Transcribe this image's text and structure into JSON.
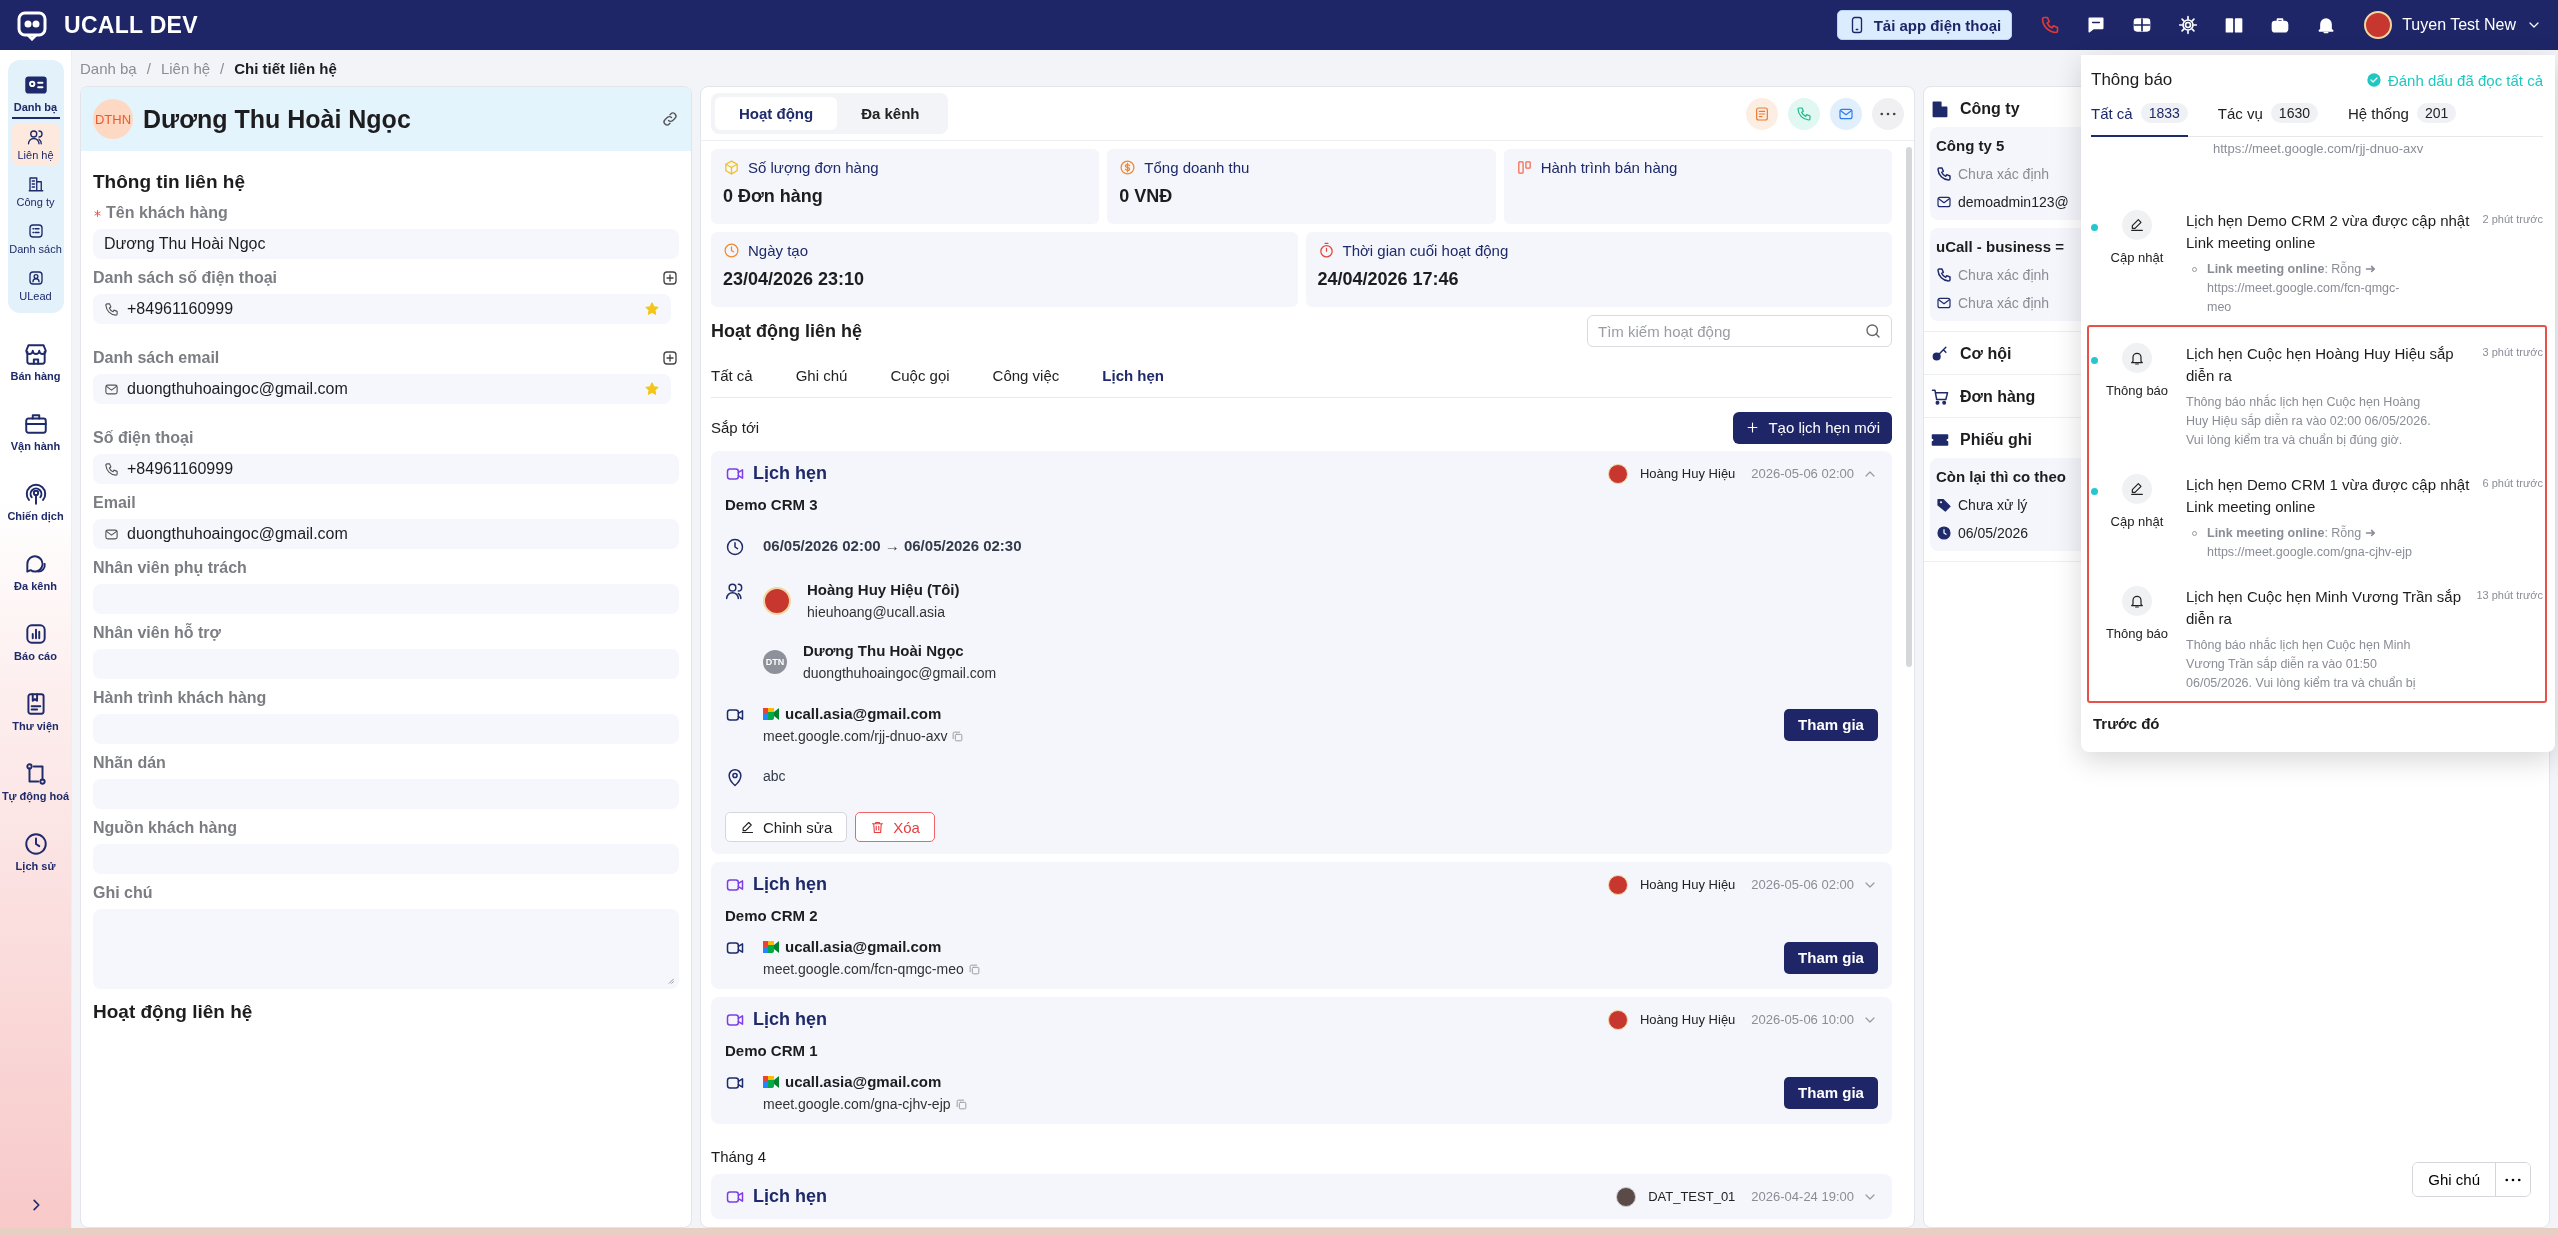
{
  "app": {
    "title": "UCALL DEV",
    "download_button": "Tải app điện thoại",
    "user_name": "Tuyen Test New"
  },
  "sidebar": {
    "items": [
      {
        "label": "Danh bạ",
        "selected": true,
        "expanded": true,
        "children": [
          {
            "label": "Liên hệ",
            "selected": true
          },
          {
            "label": "Công ty",
            "selected": false
          },
          {
            "label": "Danh sách",
            "selected": false
          },
          {
            "label": "ULead",
            "selected": false
          }
        ]
      },
      {
        "label": "Bán hàng",
        "selected": false
      },
      {
        "label": "Vận hành",
        "selected": false
      },
      {
        "label": "Chiến dịch",
        "selected": false
      },
      {
        "label": "Đa kênh",
        "selected": false
      },
      {
        "label": "Báo cáo",
        "selected": false
      },
      {
        "label": "Thư viện",
        "selected": false
      },
      {
        "label": "Tự động hoá",
        "selected": false
      },
      {
        "label": "Lịch sử",
        "selected": false
      }
    ]
  },
  "breadcrumb": {
    "separator": "/",
    "items": [
      "Danh bạ",
      "Liên hệ",
      "Chi tiết liên hệ"
    ]
  },
  "contact": {
    "initials": "DTHN",
    "name": "Dương Thu Hoài Ngọc",
    "section_title": "Thông tin liên hệ",
    "fields": [
      {
        "kind": "text",
        "label": "Tên khách hàng",
        "required": true,
        "value": "Dương Thu Hoài Ngọc"
      },
      {
        "kind": "list",
        "label": "Danh sách số điện thoại",
        "required": false,
        "entries": [
          {
            "kind": "phone",
            "value": "+84961160999",
            "starred": true
          }
        ]
      },
      {
        "kind": "list",
        "label": "Danh sách email",
        "required": false,
        "entries": [
          {
            "kind": "email",
            "value": "duongthuhoaingoc@gmail.com",
            "starred": true
          }
        ]
      },
      {
        "kind": "phone",
        "label": "Số điện thoại",
        "required": false,
        "value": "+84961160999"
      },
      {
        "kind": "email",
        "label": "Email",
        "required": false,
        "value": "duongthuhoaingoc@gmail.com"
      },
      {
        "kind": "text",
        "label": "Nhân viên phụ trách",
        "required": false
      },
      {
        "kind": "text",
        "label": "Nhân viên hỗ trợ",
        "required": false
      },
      {
        "kind": "text",
        "label": "Hành trình khách hàng",
        "required": false
      },
      {
        "kind": "text",
        "label": "Nhãn dán",
        "required": false
      },
      {
        "kind": "text",
        "label": "Nguồn khách hàng",
        "required": false
      },
      {
        "kind": "textarea",
        "label": "Ghi chú",
        "required": false
      }
    ],
    "activity_title": "Hoạt động liên hệ"
  },
  "activity": {
    "tabs": [
      {
        "label": "Hoạt động",
        "selected": true
      },
      {
        "label": "Đa kênh",
        "selected": false
      }
    ],
    "stats": [
      {
        "label": "Số lượng đơn hàng",
        "value": "0 Đơn hàng"
      },
      {
        "label": "Tổng doanh thu",
        "value": "0 VNĐ"
      },
      {
        "label": "Hành trình bán hàng"
      },
      {
        "label": "Ngày tạo",
        "value": "23/04/2026 23:10"
      },
      {
        "label": "Thời gian cuối hoạt động",
        "value": "24/04/2026 17:46"
      }
    ],
    "title": "Hoạt động liên hệ",
    "search_placeholder": "Tìm kiếm hoạt động",
    "filters": [
      {
        "label": "Tất cả",
        "selected": false
      },
      {
        "label": "Ghi chú",
        "selected": false
      },
      {
        "label": "Cuộc gọi",
        "selected": false
      },
      {
        "label": "Công việc",
        "selected": false
      },
      {
        "label": "Lịch hẹn",
        "selected": true
      }
    ],
    "create_button": "Tạo lịch hẹn mới",
    "groups": [
      {
        "label": "Sắp tới",
        "appointments": [
          {
            "type_label": "Lịch hẹn",
            "owner": "Hoàng Huy Hiệu",
            "time": "2026-05-06 02:00",
            "expanded": true,
            "name": "Demo CRM 3",
            "schedule": "06/05/2026 02:00 → 06/05/2026 02:30",
            "attendees": [
              {
                "name": "Hoàng Huy Hiệu (Tôi)",
                "email": "hieuhoang@ucall.asia"
              },
              {
                "name": "Dương Thu Hoài Ngọc",
                "email": "duongthuhoaingoc@gmail.com",
                "initials": "DTN"
              }
            ],
            "meeting": {
              "account": "ucall.asia@gmail.com",
              "link": "meet.google.com/rjj-dnuo-axv",
              "join": "Tham gia"
            },
            "location": "abc",
            "edit": "Chỉnh sửa",
            "delete": "Xóa"
          },
          {
            "type_label": "Lịch hẹn",
            "owner": "Hoàng Huy Hiệu",
            "time": "2026-05-06 02:00",
            "expanded": false,
            "name": "Demo CRM 2",
            "meeting": {
              "account": "ucall.asia@gmail.com",
              "link": "meet.google.com/fcn-qmgc-meo",
              "join": "Tham gia"
            }
          },
          {
            "type_label": "Lịch hẹn",
            "owner": "Hoàng Huy Hiệu",
            "time": "2026-05-06 10:00",
            "expanded": false,
            "name": "Demo CRM 1",
            "meeting": {
              "account": "ucall.asia@gmail.com",
              "link": "meet.google.com/gna-cjhv-ejp",
              "join": "Tham gia"
            }
          }
        ]
      },
      {
        "label": "Tháng 4",
        "appointments": [
          {
            "type_label": "Lịch hẹn",
            "owner": "DAT_TEST_01",
            "time": "2026-04-24 19:00",
            "expanded": false
          }
        ]
      }
    ]
  },
  "related": {
    "sections": [
      {
        "title": "Công ty",
        "cards": [
          {
            "title": "Công ty 5",
            "rows": [
              {
                "kind": "phone",
                "text": "Chưa xác định",
                "missing": true
              },
              {
                "kind": "email",
                "text": "demoadmin123@",
                "missing": false
              }
            ]
          },
          {
            "title": "uCall - business =",
            "rows": [
              {
                "kind": "phone",
                "text": "Chưa xác định",
                "missing": true
              },
              {
                "kind": "email",
                "text": "Chưa xác định",
                "missing": true
              }
            ]
          }
        ]
      },
      {
        "title": "Cơ hội"
      },
      {
        "title": "Đơn hàng"
      },
      {
        "title": "Phiếu ghi",
        "cards": [
          {
            "title": "Còn lại thì co theo",
            "rows": [
              {
                "kind": "status",
                "text": "Chưa xử lý",
                "missing": false
              },
              {
                "kind": "date",
                "text": "06/05/2026",
                "missing": false
              }
            ]
          }
        ]
      }
    ],
    "note_button": "Ghi chú"
  },
  "notifications": {
    "title": "Thông báo",
    "mark_all": "Đánh dấu đã đọc tất cả",
    "tabs": [
      {
        "label": "Tất cả",
        "count": "1833",
        "selected": true
      },
      {
        "label": "Tác vụ",
        "count": "1630",
        "selected": false
      },
      {
        "label": "Hệ thống",
        "count": "201",
        "selected": false
      }
    ],
    "items": [
      {
        "kind": "fragment",
        "detail": "https://meet.google.com/rjj-dnuo-axv",
        "highlighted": false
      },
      {
        "kind": "update",
        "type_label": "Cập nhật",
        "unread": true,
        "title": "Lịch hẹn Demo CRM 2 vừa được cập nhật Link meeting online",
        "time": "2 phút trước",
        "change": "**Link meeting online**: Rỗng ➜ https://meet.google.com/fcn-qmgc-meo",
        "highlighted": false
      },
      {
        "kind": "reminder",
        "type_label": "Thông báo",
        "unread": true,
        "title": "Lịch hẹn Cuộc hẹn Hoàng Huy Hiệu sắp diễn ra",
        "time": "3 phút trước",
        "body": "Thông báo nhắc lịch hẹn Cuộc hẹn Hoàng Huy Hiệu sắp diễn ra vào 02:00 06/05/2026. Vui lòng kiểm tra và chuẩn bị đúng giờ.",
        "highlighted": true
      },
      {
        "kind": "update",
        "type_label": "Cập nhật",
        "unread": true,
        "title": "Lịch hẹn Demo CRM 1 vừa được cập nhật Link meeting online",
        "time": "6 phút trước",
        "change": "**Link meeting online**: Rỗng ➜ https://meet.google.com/gna-cjhv-ejp",
        "highlighted": true
      },
      {
        "kind": "reminder",
        "type_label": "Thông báo",
        "unread": false,
        "title": "Lịch hẹn Cuộc hẹn Minh Vương Trần sắp diễn ra",
        "time": "13 phút trước",
        "body": "Thông báo nhắc lịch hẹn Cuộc hẹn Minh Vương Trần sắp diễn ra vào 01:50 06/05/2026. Vui lòng kiểm tra và chuẩn bị",
        "highlighted": true
      }
    ],
    "section_label": "Trước đó"
  }
}
